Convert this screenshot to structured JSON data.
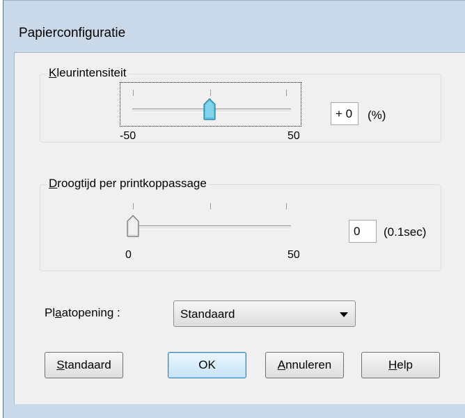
{
  "window": {
    "title": "Papierconfiguratie"
  },
  "color_intensity": {
    "label_mnemonic": "K",
    "label_rest": "leurintensiteit",
    "min_label": "-50",
    "max_label": "50",
    "min": -50,
    "max": 50,
    "value": 0,
    "input_value": "+ 0",
    "unit": "(%)"
  },
  "drying_time": {
    "label_mnemonic": "D",
    "label_rest": "roogtijd per printkoppassage",
    "min_label": "0",
    "max_label": "50",
    "min": 0,
    "max": 50,
    "value": 0,
    "input_value": "0",
    "unit": "(0.1sec)"
  },
  "platen_gap": {
    "label_pre": "Pl",
    "label_mnemonic": "a",
    "label_post": "atopening :",
    "selected": "Standaard"
  },
  "buttons": {
    "standard_mnemonic": "S",
    "standard_rest": "tandaard",
    "ok": "OK",
    "cancel_mnemonic": "A",
    "cancel_rest": "nnuleren",
    "help_mnemonic": "H",
    "help_rest": "elp"
  },
  "colors": {
    "thumb_active": "#5bbfe0",
    "thumb_inactive": "#e4e4e4",
    "default_button_border": "#3c7fb1"
  }
}
